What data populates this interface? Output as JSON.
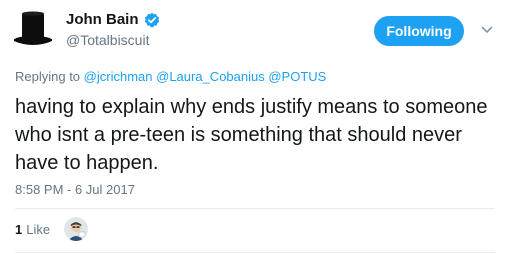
{
  "author": {
    "name": "John Bain",
    "handle": "@Totalbiscuit",
    "verified": true
  },
  "follow_button": {
    "label": "Following"
  },
  "reply": {
    "prefix": "Replying to",
    "mentions": [
      "@jcrichman",
      "@Laura_Cobanius",
      "@POTUS"
    ]
  },
  "tweet": {
    "text": "having to explain why ends justify means to someone who isnt a pre-teen is something that should never have to happen.",
    "timestamp": "8:58 PM - 6 Jul 2017"
  },
  "stats": {
    "like_count": "1",
    "like_label": "Like"
  },
  "colors": {
    "accent": "#1da1f2",
    "text": "#14171a",
    "muted": "#657786",
    "divider": "#e6ecf0"
  },
  "icons": {
    "avatar": "top-hat-icon",
    "verified": "verified-badge-icon",
    "more": "chevron-down-icon"
  }
}
